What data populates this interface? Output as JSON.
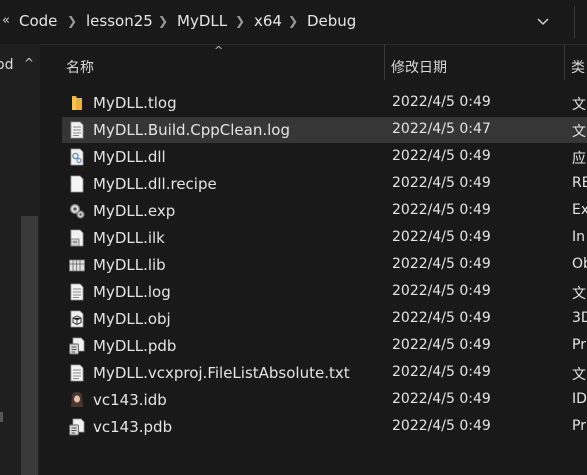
{
  "breadcrumb": {
    "overflow": "«",
    "items": [
      "Code",
      "lesson25",
      "MyDLL",
      "x64",
      "Debug"
    ]
  },
  "nav": {
    "partial_label": "od",
    "caret": "^"
  },
  "columns": {
    "name": "名称",
    "modified": "修改日期",
    "type_partial": "类",
    "sort_indicator": "^"
  },
  "files": [
    {
      "icon": "folder-icon",
      "name": "MyDLL.tlog",
      "modified": "2022/4/5 0:49",
      "type": "文"
    },
    {
      "icon": "text-file-icon",
      "name": "MyDLL.Build.CppClean.log",
      "modified": "2022/4/5 0:47",
      "type": "文"
    },
    {
      "icon": "dll-icon",
      "name": "MyDLL.dll",
      "modified": "2022/4/5 0:49",
      "type": "应"
    },
    {
      "icon": "blank-file-icon",
      "name": "MyDLL.dll.recipe",
      "modified": "2022/4/5 0:49",
      "type": "RE"
    },
    {
      "icon": "exp-icon",
      "name": "MyDLL.exp",
      "modified": "2022/4/5 0:49",
      "type": "Ex"
    },
    {
      "icon": "ilk-icon",
      "name": "MyDLL.ilk",
      "modified": "2022/4/5 0:49",
      "type": "In"
    },
    {
      "icon": "lib-icon",
      "name": "MyDLL.lib",
      "modified": "2022/4/5 0:49",
      "type": "Ob"
    },
    {
      "icon": "text-file-icon",
      "name": "MyDLL.log",
      "modified": "2022/4/5 0:49",
      "type": "文"
    },
    {
      "icon": "obj-icon",
      "name": "MyDLL.obj",
      "modified": "2022/4/5 0:49",
      "type": "3D"
    },
    {
      "icon": "pdb-icon",
      "name": "MyDLL.pdb",
      "modified": "2022/4/5 0:49",
      "type": "Pr"
    },
    {
      "icon": "text-file-icon",
      "name": "MyDLL.vcxproj.FileListAbsolute.txt",
      "modified": "2022/4/5 0:49",
      "type": "文"
    },
    {
      "icon": "idb-icon",
      "name": "vc143.idb",
      "modified": "2022/4/5 0:49",
      "type": "ID"
    },
    {
      "icon": "pdb-icon",
      "name": "vc143.pdb",
      "modified": "2022/4/5 0:49",
      "type": "Pr"
    }
  ],
  "selected_row": 1
}
